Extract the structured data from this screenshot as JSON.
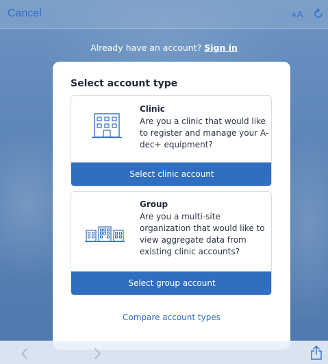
{
  "topbar": {
    "cancel_label": "Cancel",
    "text_size_label": "AA",
    "text_size_icon": "text-size-icon",
    "reload_icon": "reload-icon"
  },
  "signin": {
    "prompt": "Already have an account?",
    "link_label": "Sign in"
  },
  "card": {
    "title": "Select account type",
    "options": [
      {
        "icon": "building-icon",
        "title": "Clinic",
        "description": "Are you a clinic that would like to register and manage your A-dec+ equipment?",
        "button_label": "Select clinic account"
      },
      {
        "icon": "buildings-group-icon",
        "title": "Group",
        "description": "Are you a multi-site organization that would like to view aggregate data from existing clinic accounts?",
        "button_label": "Select group account"
      }
    ],
    "compare_link": "Compare account types"
  },
  "bottombar": {
    "back_icon": "chevron-left-icon",
    "forward_icon": "chevron-right-icon",
    "share_icon": "share-icon"
  },
  "colors": {
    "accent": "#2f6ec0",
    "link_blue": "#2f6fd0",
    "background": "#5f88b8"
  }
}
